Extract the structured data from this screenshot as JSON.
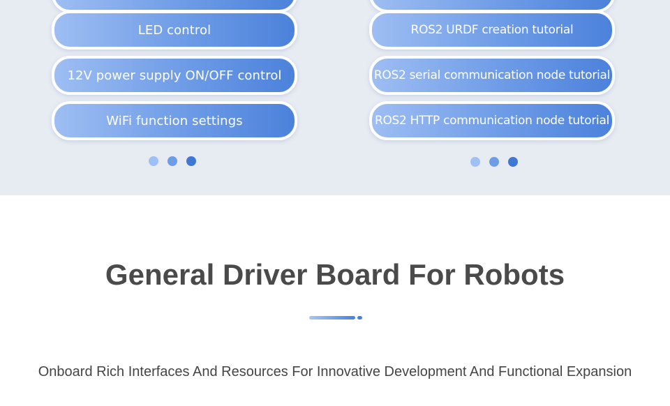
{
  "left_panel": {
    "items": [
      {
        "label": "LED control"
      },
      {
        "label": "12V power supply ON/OFF control"
      },
      {
        "label": "WiFi function settings"
      }
    ]
  },
  "right_panel": {
    "items": [
      {
        "label": "ROS2 URDF creation tutorial"
      },
      {
        "label": "ROS2 serial communication node tutorial"
      },
      {
        "label": "ROS2 HTTP communication node tutorial"
      }
    ]
  },
  "section": {
    "title": "General Driver Board For Robots",
    "subtitle": "Onboard Rich Interfaces And Resources For Innovative Development And Functional Expansion"
  },
  "colors": {
    "pill_gradient_start": "#9ebef3",
    "pill_gradient_end": "#4c82db",
    "panel_background": "#e7ebf2",
    "dot_light": "#9ec0f5",
    "dot_mid": "#6f9ce6",
    "dot_active": "#3f77d4",
    "title_text": "#4a4a4a"
  }
}
